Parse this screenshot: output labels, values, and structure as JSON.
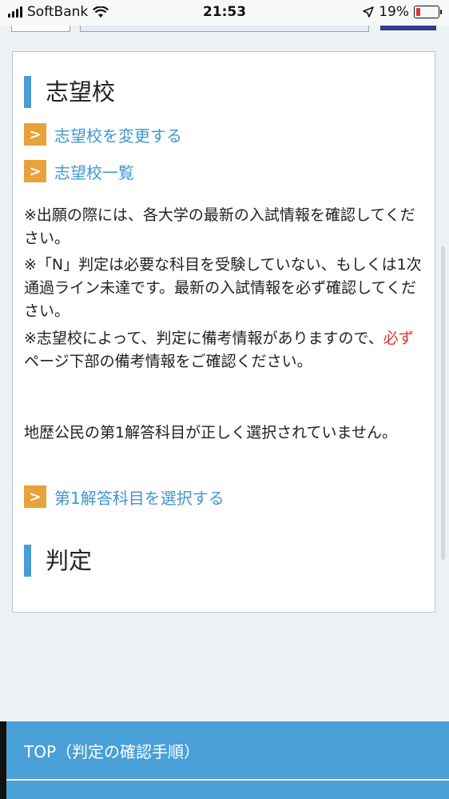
{
  "status_bar": {
    "carrier": "SoftBank",
    "time": "21:53",
    "battery_percent": "19%",
    "battery_level": 0.19
  },
  "card": {
    "heading_school": "志望校",
    "link_change_school": "志望校を変更する",
    "link_school_list": "志望校一覧",
    "note_1": "※出願の際には、各大学の最新の入試情報を確認してください。",
    "note_2": "※「N」判定は必要な科目を受験していない、もしくは1次通過ライン未達です。最新の入試情報を必ず確認してください。",
    "note_3_prefix": "※志望校によって、判定に備考情報がありますので、",
    "note_3_emphasis": "必ず",
    "note_3_suffix": "ページ下部の備考情報をご確認ください。",
    "warning_text": "地歴公民の第1解答科目が正しく選択されていません。",
    "link_select_subject": "第1解答科目を選択する",
    "heading_judgement": "判定"
  },
  "bottom_nav": {
    "top_label": "TOP（判定の確認手順）"
  },
  "colors": {
    "accent_blue": "#4a9cd4",
    "link_blue": "#3f97d2",
    "arrow_orange": "#e8a23a",
    "emphasis_red": "#e3342f",
    "nav_blue": "#4aa0d8"
  },
  "icons": [
    "signal-icon",
    "wifi-icon",
    "location-arrow-icon",
    "battery-icon",
    "chevron-right-icon"
  ]
}
